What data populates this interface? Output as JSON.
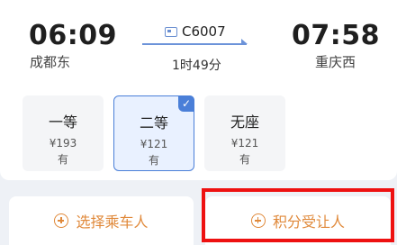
{
  "train": {
    "depart_time": "06:09",
    "depart_station": "成都东",
    "code": "C6007",
    "duration": "1时49分",
    "arrive_time": "07:58",
    "arrive_station": "重庆西"
  },
  "seats": [
    {
      "name": "一等",
      "price": "¥193",
      "availability": "有"
    },
    {
      "name": "二等",
      "price": "¥121",
      "availability": "有"
    },
    {
      "name": "无座",
      "price": "¥121",
      "availability": "有"
    }
  ],
  "actions": {
    "select_passenger": "选择乘车人",
    "points_transfer": "积分受让人"
  },
  "colors": {
    "accent": "#4a7fd8",
    "action": "#e0893a",
    "highlight_box": "#e11111"
  }
}
